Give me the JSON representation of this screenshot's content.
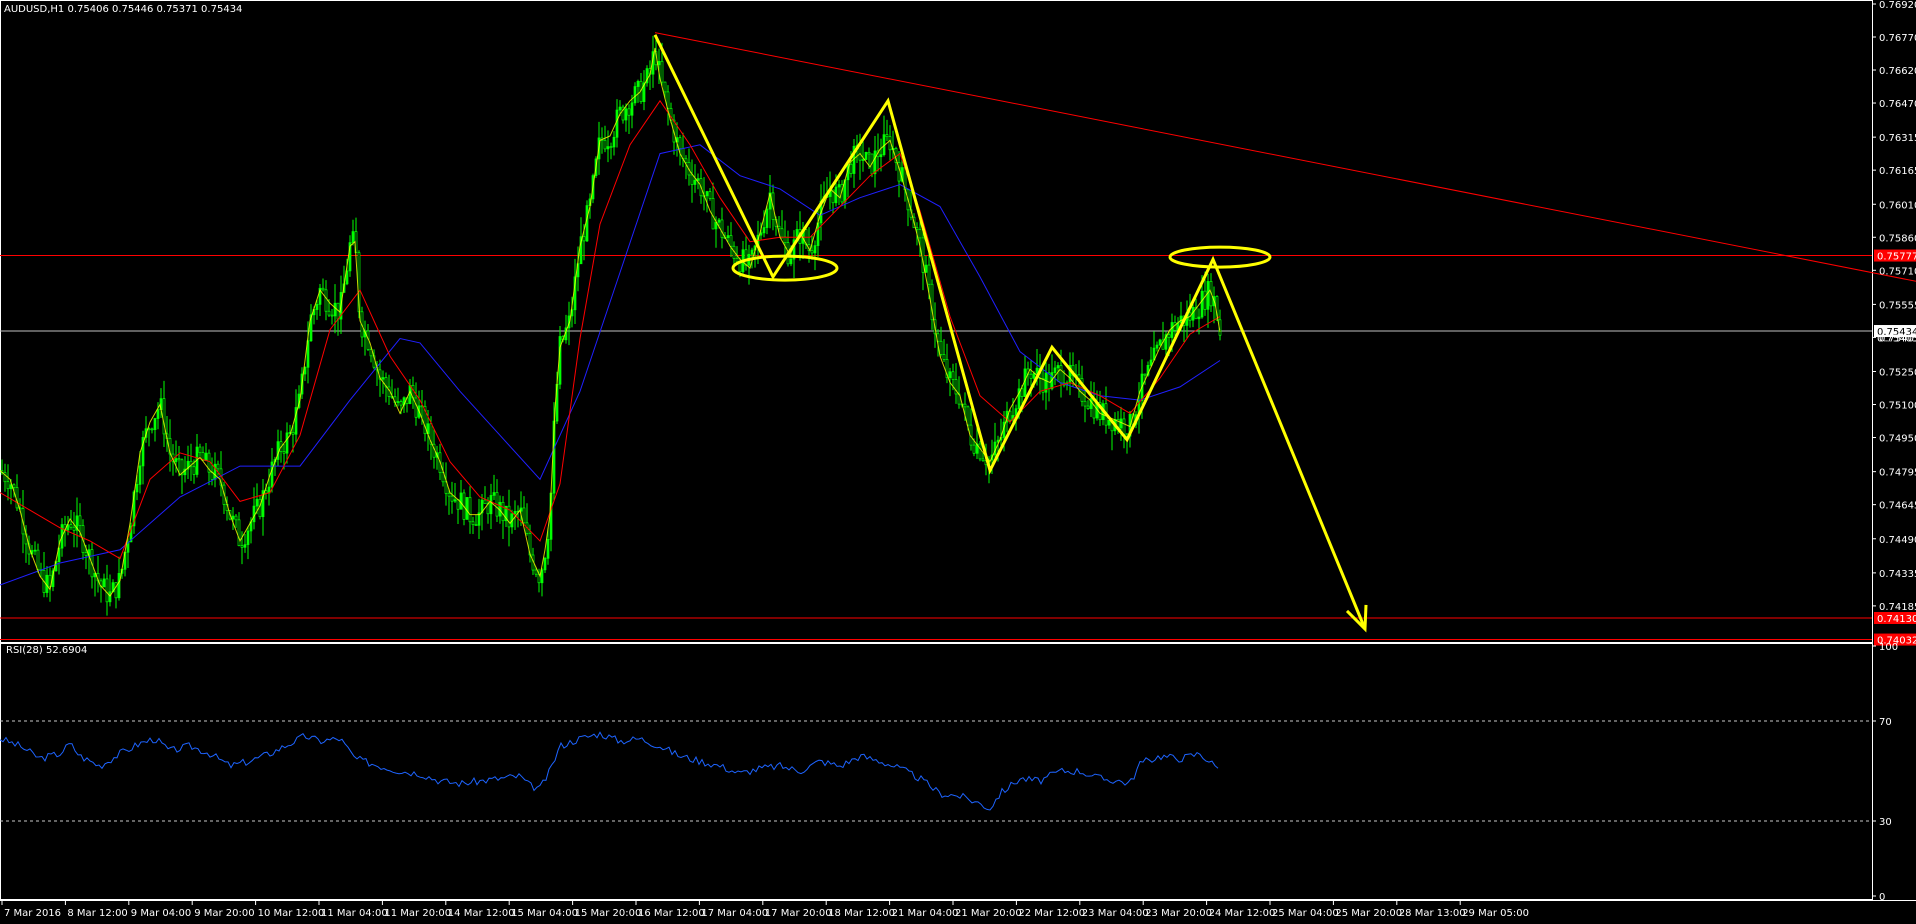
{
  "header": {
    "symbol_line": "AUDUSD,H1  0.75406 0.75446 0.75371 0.75434"
  },
  "rsi_panel": {
    "label": "RSI(28) 52.6904"
  },
  "colors": {
    "background": "#000000",
    "candle": "#00ff00",
    "ma_fast": "#ff0000",
    "ma_slow": "#2020ff",
    "ma_yellow": "#ffff00",
    "pattern": "#ffff00",
    "trendline": "#ff0000",
    "level": "#ff0000",
    "current_price": "#c0c0c0",
    "rsi_line": "#1e64ff",
    "axis": "#ffffff"
  },
  "chart_data": [
    {
      "type": "line",
      "symbol": "AUDUSD",
      "timeframe": "H1",
      "ylim": [
        0.7403,
        0.7692
      ],
      "y_ticks": [
        "0.76920",
        "0.76770",
        "0.76620",
        "0.76470",
        "0.76315",
        "0.76165",
        "0.76010",
        "0.75860",
        "0.75710",
        "0.75555",
        "0.75405",
        "0.75250",
        "0.75100",
        "0.74950",
        "0.74795",
        "0.74645",
        "0.74490",
        "0.74335",
        "0.74185"
      ],
      "x_ticks": [
        "7 Mar 2016",
        "8 Mar 12:00",
        "9 Mar 04:00",
        "9 Mar 20:00",
        "10 Mar 12:00",
        "11 Mar 04:00",
        "11 Mar 20:00",
        "14 Mar 12:00",
        "15 Mar 04:00",
        "15 Mar 20:00",
        "16 Mar 12:00",
        "17 Mar 04:00",
        "17 Mar 20:00",
        "18 Mar 12:00",
        "21 Mar 04:00",
        "21 Mar 20:00",
        "22 Mar 12:00",
        "23 Mar 04:00",
        "23 Mar 20:00",
        "24 Mar 12:00",
        "25 Mar 04:00",
        "25 Mar 20:00",
        "28 Mar 13:00",
        "29 Mar 05:00"
      ],
      "price_labels": [
        {
          "value": 0.75777,
          "text": "0.75777",
          "style": "level"
        },
        {
          "value": 0.75434,
          "text": "0.75434",
          "style": "current"
        },
        {
          "value": 0.75405,
          "text": "0.75405",
          "style": "plain"
        },
        {
          "value": 0.7413,
          "text": "0.74130",
          "style": "level"
        },
        {
          "value": 0.74032,
          "text": "0.74032",
          "style": "level"
        }
      ],
      "levels": [
        0.75777,
        0.7413,
        0.74032
      ],
      "current_price": 0.75434,
      "series_close": [
        [
          0,
          0.748
        ],
        [
          10,
          0.7476
        ],
        [
          20,
          0.7462
        ],
        [
          30,
          0.7444
        ],
        [
          40,
          0.7432
        ],
        [
          50,
          0.7426
        ],
        [
          60,
          0.7448
        ],
        [
          70,
          0.7458
        ],
        [
          80,
          0.7452
        ],
        [
          90,
          0.744
        ],
        [
          100,
          0.7428
        ],
        [
          110,
          0.7423
        ],
        [
          120,
          0.743
        ],
        [
          130,
          0.7456
        ],
        [
          140,
          0.7488
        ],
        [
          150,
          0.7502
        ],
        [
          160,
          0.751
        ],
        [
          170,
          0.7488
        ],
        [
          180,
          0.7478
        ],
        [
          190,
          0.7482
        ],
        [
          200,
          0.7486
        ],
        [
          210,
          0.748
        ],
        [
          220,
          0.7476
        ],
        [
          230,
          0.746
        ],
        [
          240,
          0.7448
        ],
        [
          250,
          0.7456
        ],
        [
          260,
          0.7464
        ],
        [
          270,
          0.7478
        ],
        [
          280,
          0.749
        ],
        [
          290,
          0.7496
        ],
        [
          300,
          0.7512
        ],
        [
          310,
          0.7548
        ],
        [
          320,
          0.7562
        ],
        [
          330,
          0.7556
        ],
        [
          340,
          0.7552
        ],
        [
          350,
          0.7582
        ],
        [
          355,
          0.7584
        ],
        [
          360,
          0.7548
        ],
        [
          370,
          0.7538
        ],
        [
          380,
          0.7522
        ],
        [
          390,
          0.7516
        ],
        [
          400,
          0.7506
        ],
        [
          410,
          0.7516
        ],
        [
          420,
          0.7506
        ],
        [
          430,
          0.7494
        ],
        [
          440,
          0.7484
        ],
        [
          450,
          0.747
        ],
        [
          460,
          0.7466
        ],
        [
          470,
          0.746
        ],
        [
          480,
          0.746
        ],
        [
          490,
          0.7466
        ],
        [
          500,
          0.7462
        ],
        [
          510,
          0.7456
        ],
        [
          520,
          0.7462
        ],
        [
          530,
          0.7442
        ],
        [
          540,
          0.7432
        ],
        [
          545,
          0.7444
        ],
        [
          550,
          0.746
        ],
        [
          555,
          0.7508
        ],
        [
          560,
          0.7536
        ],
        [
          570,
          0.7548
        ],
        [
          580,
          0.7582
        ],
        [
          590,
          0.76
        ],
        [
          600,
          0.763
        ],
        [
          610,
          0.7632
        ],
        [
          620,
          0.7642
        ],
        [
          630,
          0.7648
        ],
        [
          640,
          0.7652
        ],
        [
          650,
          0.766
        ],
        [
          655,
          0.7672
        ],
        [
          660,
          0.7658
        ],
        [
          670,
          0.764
        ],
        [
          680,
          0.7624
        ],
        [
          690,
          0.7616
        ],
        [
          700,
          0.761
        ],
        [
          710,
          0.7598
        ],
        [
          720,
          0.759
        ],
        [
          730,
          0.7582
        ],
        [
          740,
          0.7576
        ],
        [
          750,
          0.7572
        ],
        [
          760,
          0.7588
        ],
        [
          770,
          0.7606
        ],
        [
          780,
          0.7586
        ],
        [
          790,
          0.7578
        ],
        [
          800,
          0.7588
        ],
        [
          810,
          0.758
        ],
        [
          820,
          0.7596
        ],
        [
          830,
          0.7608
        ],
        [
          840,
          0.7604
        ],
        [
          850,
          0.762
        ],
        [
          860,
          0.7624
        ],
        [
          870,
          0.7618
        ],
        [
          880,
          0.7626
        ],
        [
          890,
          0.763
        ],
        [
          900,
          0.7616
        ],
        [
          910,
          0.76
        ],
        [
          920,
          0.7582
        ],
        [
          930,
          0.7558
        ],
        [
          940,
          0.7532
        ],
        [
          950,
          0.752
        ],
        [
          960,
          0.7514
        ],
        [
          970,
          0.7496
        ],
        [
          980,
          0.749
        ],
        [
          990,
          0.7484
        ],
        [
          1000,
          0.7494
        ],
        [
          1010,
          0.7508
        ],
        [
          1020,
          0.7516
        ],
        [
          1030,
          0.7526
        ],
        [
          1040,
          0.7522
        ],
        [
          1050,
          0.752
        ],
        [
          1060,
          0.7526
        ],
        [
          1070,
          0.7522
        ],
        [
          1080,
          0.7516
        ],
        [
          1090,
          0.7512
        ],
        [
          1100,
          0.7506
        ],
        [
          1110,
          0.7504
        ],
        [
          1120,
          0.7502
        ],
        [
          1130,
          0.75
        ],
        [
          1140,
          0.7516
        ],
        [
          1150,
          0.7526
        ],
        [
          1160,
          0.7536
        ],
        [
          1170,
          0.7544
        ],
        [
          1180,
          0.7548
        ],
        [
          1190,
          0.755
        ],
        [
          1200,
          0.7556
        ],
        [
          1210,
          0.7562
        ],
        [
          1215,
          0.7556
        ],
        [
          1220,
          0.7543
        ]
      ],
      "series_ma_red": [
        [
          0,
          0.747
        ],
        [
          30,
          0.7462
        ],
        [
          60,
          0.7454
        ],
        [
          90,
          0.7448
        ],
        [
          120,
          0.744
        ],
        [
          150,
          0.7476
        ],
        [
          180,
          0.7488
        ],
        [
          210,
          0.7484
        ],
        [
          240,
          0.7466
        ],
        [
          270,
          0.747
        ],
        [
          300,
          0.7496
        ],
        [
          330,
          0.7544
        ],
        [
          360,
          0.7562
        ],
        [
          390,
          0.7532
        ],
        [
          420,
          0.7512
        ],
        [
          450,
          0.7484
        ],
        [
          480,
          0.7468
        ],
        [
          510,
          0.7462
        ],
        [
          540,
          0.7448
        ],
        [
          560,
          0.7474
        ],
        [
          580,
          0.754
        ],
        [
          600,
          0.7592
        ],
        [
          630,
          0.7628
        ],
        [
          660,
          0.7648
        ],
        [
          690,
          0.7628
        ],
        [
          720,
          0.7604
        ],
        [
          750,
          0.7584
        ],
        [
          780,
          0.7586
        ],
        [
          810,
          0.7586
        ],
        [
          840,
          0.76
        ],
        [
          870,
          0.7614
        ],
        [
          900,
          0.7624
        ],
        [
          920,
          0.7598
        ],
        [
          950,
          0.755
        ],
        [
          980,
          0.7514
        ],
        [
          1010,
          0.7502
        ],
        [
          1040,
          0.7516
        ],
        [
          1070,
          0.752
        ],
        [
          1100,
          0.7514
        ],
        [
          1130,
          0.7506
        ],
        [
          1160,
          0.7522
        ],
        [
          1190,
          0.7542
        ],
        [
          1220,
          0.755
        ]
      ],
      "series_ma_blue": [
        [
          0,
          0.7428
        ],
        [
          60,
          0.7438
        ],
        [
          120,
          0.7444
        ],
        [
          180,
          0.7468
        ],
        [
          240,
          0.7482
        ],
        [
          300,
          0.7482
        ],
        [
          350,
          0.7512
        ],
        [
          400,
          0.754
        ],
        [
          420,
          0.7538
        ],
        [
          460,
          0.7516
        ],
        [
          500,
          0.7496
        ],
        [
          540,
          0.7476
        ],
        [
          580,
          0.7516
        ],
        [
          620,
          0.757
        ],
        [
          660,
          0.7624
        ],
        [
          700,
          0.7628
        ],
        [
          740,
          0.7614
        ],
        [
          780,
          0.7608
        ],
        [
          820,
          0.7596
        ],
        [
          860,
          0.7604
        ],
        [
          900,
          0.761
        ],
        [
          940,
          0.76
        ],
        [
          980,
          0.7568
        ],
        [
          1020,
          0.7534
        ],
        [
          1060,
          0.752
        ],
        [
          1100,
          0.7514
        ],
        [
          1140,
          0.7512
        ],
        [
          1180,
          0.7518
        ],
        [
          1220,
          0.753
        ]
      ],
      "pattern_path": [
        [
          655,
          0.7678
        ],
        [
          773,
          0.7568
        ],
        [
          888,
          0.7648
        ],
        [
          990,
          0.748
        ],
        [
          1052,
          0.7536
        ],
        [
          1127,
          0.7494
        ],
        [
          1213,
          0.7576
        ],
        [
          1365,
          0.7408
        ]
      ],
      "trendline": [
        [
          655,
          0.7679
        ],
        [
          1916,
          0.7566
        ]
      ],
      "ellipses": [
        [
          785,
          0.7572
        ],
        [
          1220,
          0.7577
        ]
      ]
    },
    {
      "type": "line",
      "name": "RSI(28)",
      "value": 52.6904,
      "ylim": [
        0,
        100
      ],
      "y_ticks": [
        "100",
        "70",
        "30",
        "0"
      ],
      "levels": [
        70,
        30
      ],
      "series": [
        [
          0,
          63
        ],
        [
          20,
          60
        ],
        [
          40,
          55
        ],
        [
          60,
          57
        ],
        [
          70,
          61
        ],
        [
          80,
          56
        ],
        [
          100,
          52
        ],
        [
          120,
          57
        ],
        [
          140,
          61
        ],
        [
          155,
          63
        ],
        [
          170,
          58
        ],
        [
          190,
          60
        ],
        [
          210,
          57
        ],
        [
          230,
          52
        ],
        [
          250,
          54
        ],
        [
          270,
          57
        ],
        [
          290,
          61
        ],
        [
          305,
          64
        ],
        [
          320,
          62
        ],
        [
          340,
          63
        ],
        [
          355,
          55
        ],
        [
          380,
          52
        ],
        [
          400,
          50
        ],
        [
          420,
          49
        ],
        [
          440,
          46
        ],
        [
          460,
          45
        ],
        [
          480,
          46
        ],
        [
          500,
          47
        ],
        [
          520,
          48
        ],
        [
          530,
          44
        ],
        [
          540,
          43
        ],
        [
          550,
          50
        ],
        [
          560,
          60
        ],
        [
          580,
          63
        ],
        [
          600,
          65
        ],
        [
          620,
          62
        ],
        [
          640,
          63
        ],
        [
          660,
          60
        ],
        [
          680,
          56
        ],
        [
          700,
          54
        ],
        [
          720,
          52
        ],
        [
          740,
          49
        ],
        [
          760,
          51
        ],
        [
          780,
          52
        ],
        [
          800,
          50
        ],
        [
          820,
          54
        ],
        [
          840,
          52
        ],
        [
          860,
          56
        ],
        [
          880,
          54
        ],
        [
          900,
          51
        ],
        [
          920,
          47
        ],
        [
          940,
          41
        ],
        [
          960,
          40
        ],
        [
          980,
          37
        ],
        [
          990,
          35
        ],
        [
          1000,
          41
        ],
        [
          1020,
          47
        ],
        [
          1040,
          46
        ],
        [
          1060,
          50
        ],
        [
          1080,
          50
        ],
        [
          1100,
          47
        ],
        [
          1120,
          46
        ],
        [
          1130,
          45
        ],
        [
          1140,
          53
        ],
        [
          1160,
          56
        ],
        [
          1180,
          55
        ],
        [
          1200,
          57
        ],
        [
          1215,
          52
        ],
        [
          1220,
          52.7
        ]
      ]
    }
  ]
}
